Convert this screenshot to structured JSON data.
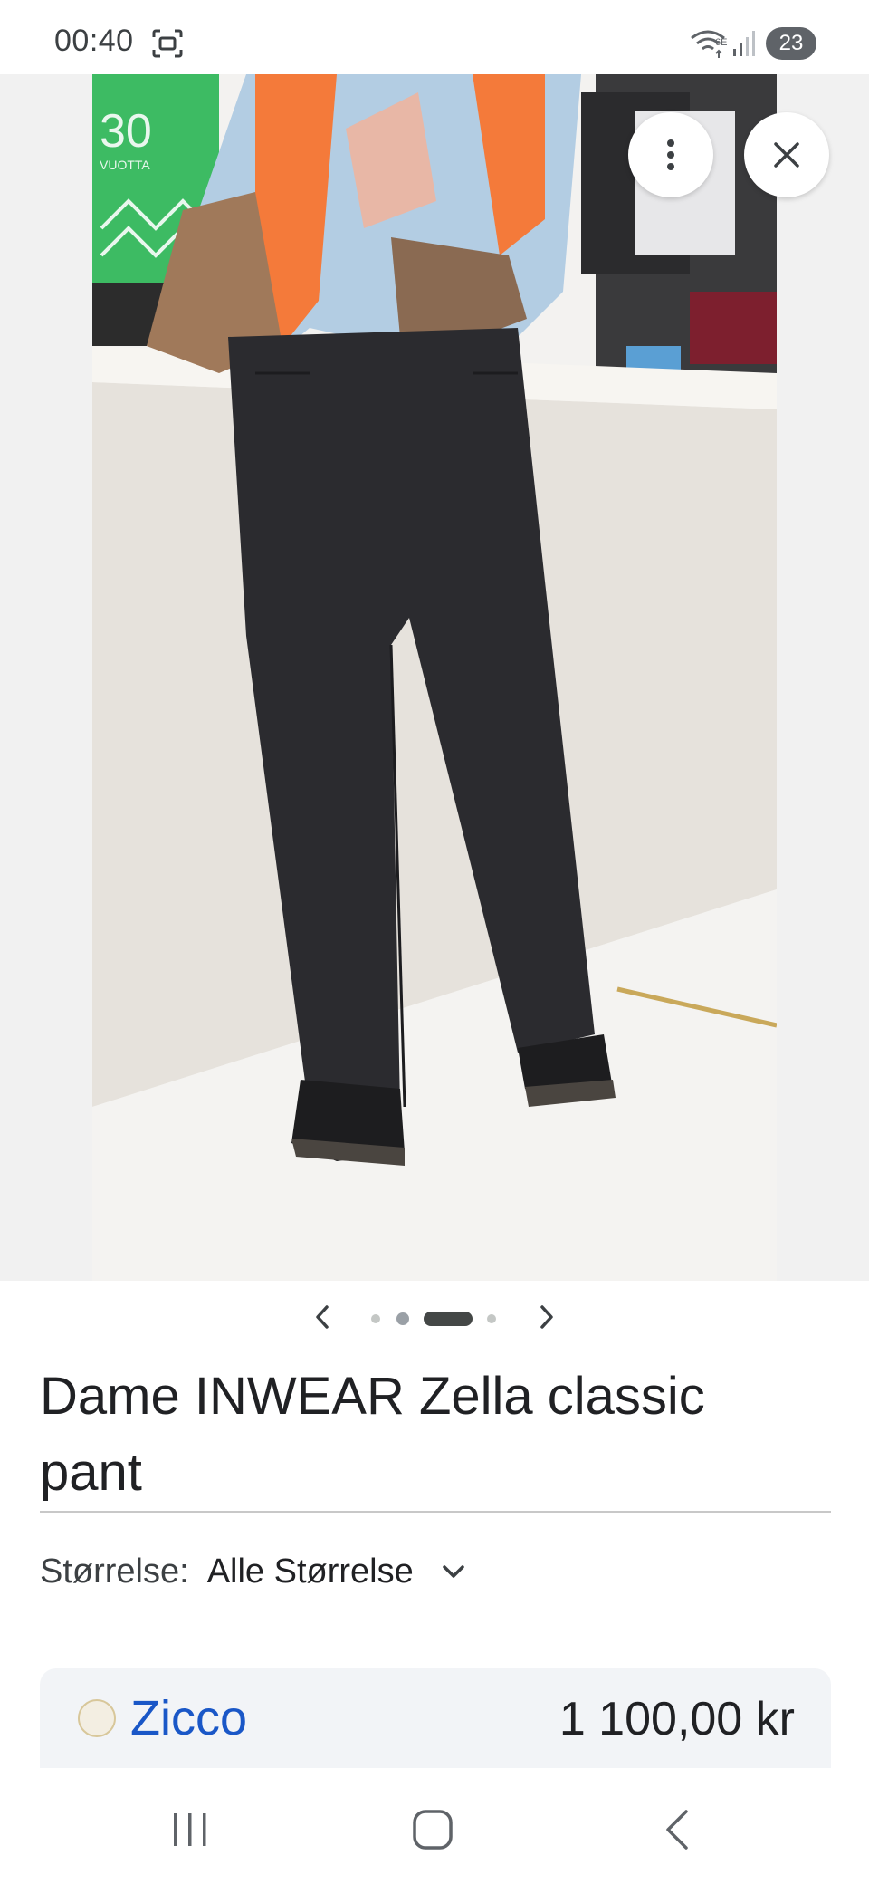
{
  "status_bar": {
    "time": "00:40",
    "battery": "23",
    "icons": [
      "screenshot-icon",
      "wifi-6e-icon",
      "signal-icon",
      "battery-icon"
    ]
  },
  "viewer": {
    "image_alt": "Dame INWEAR Zella classic pant",
    "logo_text": "30",
    "logo_subtext": "VUOTTA",
    "carousel_total": 4,
    "carousel_active_index": 2
  },
  "product": {
    "title": "Dame INWEAR Zella classic pant"
  },
  "size": {
    "label": "Størrelse:",
    "value": "Alle Størrelse"
  },
  "seller": {
    "name": "Zicco",
    "price": "1 100,00 kr"
  },
  "colors": {
    "seller_link": "#1a57c7",
    "card_bg": "#f2f4f7"
  }
}
